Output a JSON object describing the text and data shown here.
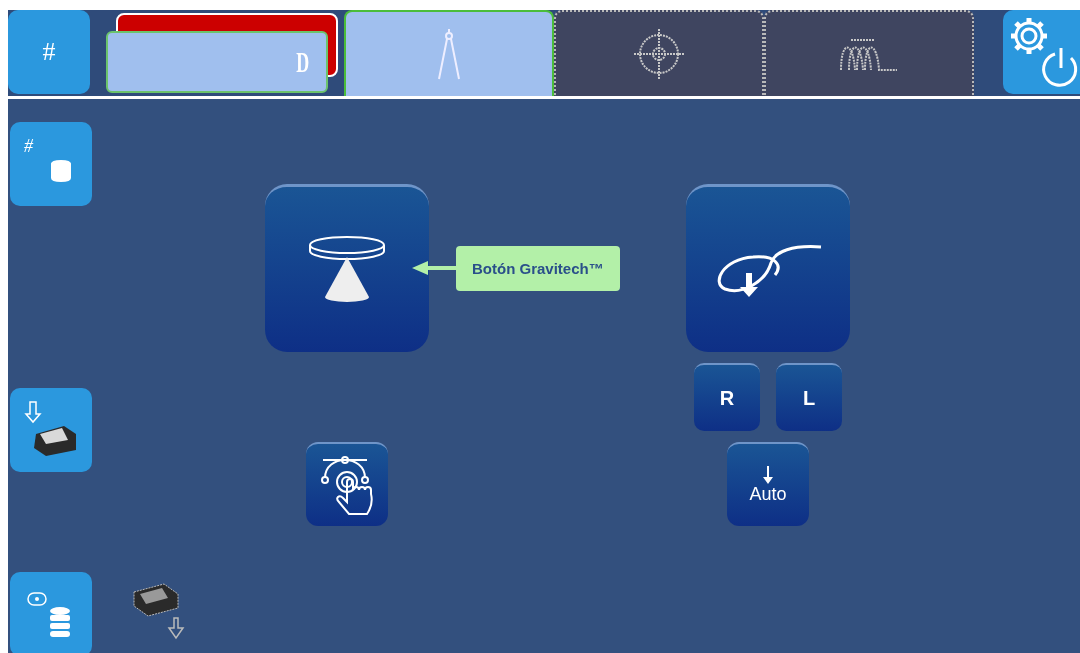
{
  "top_bar": {
    "menu_button": {
      "label": "#"
    },
    "job_field": {
      "value": "D"
    },
    "tabs": [
      {
        "kind": "compass",
        "selected": true
      },
      {
        "kind": "target",
        "selected": false
      },
      {
        "kind": "coil",
        "selected": false
      }
    ]
  },
  "sidebar": {
    "buttons": [
      {
        "kind": "database",
        "label": "#"
      },
      {
        "kind": "printer-in"
      },
      {
        "kind": "tag-database"
      }
    ]
  },
  "main": {
    "callout": {
      "text": "Botón Gravitech™"
    },
    "side_buttons": [
      {
        "label": "R"
      },
      {
        "label": "L"
      }
    ],
    "auto_button": {
      "label": "Auto"
    }
  }
}
